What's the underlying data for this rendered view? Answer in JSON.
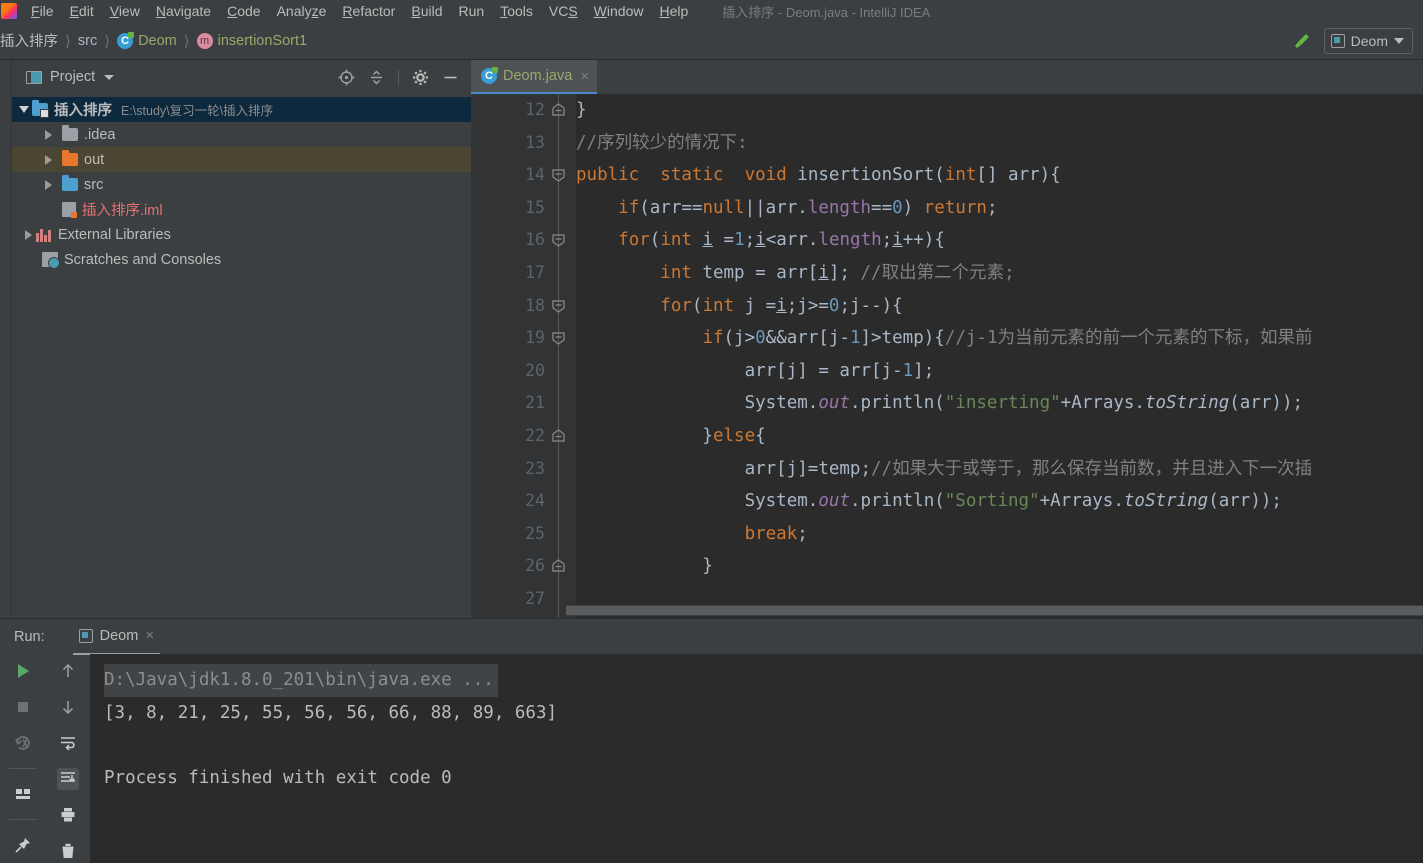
{
  "window": {
    "title": "插入排序 - Deom.java - IntelliJ IDEA"
  },
  "menubar": {
    "items": [
      {
        "label": "File"
      },
      {
        "label": "Edit"
      },
      {
        "label": "View"
      },
      {
        "label": "Navigate"
      },
      {
        "label": "Code"
      },
      {
        "label": "Analyze"
      },
      {
        "label": "Refactor"
      },
      {
        "label": "Build"
      },
      {
        "label": "Run"
      },
      {
        "label": "Tools"
      },
      {
        "label": "VCS"
      },
      {
        "label": "Window"
      },
      {
        "label": "Help"
      }
    ]
  },
  "navbar": {
    "crumbs": [
      {
        "label": "插入排序",
        "icon": "none"
      },
      {
        "label": "src",
        "icon": "none"
      },
      {
        "label": "Deom",
        "icon": "class-icon"
      },
      {
        "label": "insertionSort1",
        "icon": "method-icon"
      }
    ],
    "build_icon": "hammer-icon",
    "run_config": {
      "label": "Deom",
      "icon": "run-window-icon"
    }
  },
  "project_panel": {
    "title": "Project",
    "toolbar": [
      {
        "name": "locate-icon"
      },
      {
        "name": "collapse-all-icon"
      },
      {
        "name": "gear-icon"
      },
      {
        "name": "minimize-icon"
      }
    ],
    "tree": [
      {
        "label": "插入排序",
        "path": "E:\\study\\复习一轮\\插入排序",
        "indent": 0,
        "twisty": "down",
        "icon": "module-folder",
        "state": "selected"
      },
      {
        "label": ".idea",
        "path": "",
        "indent": 1,
        "twisty": "right",
        "icon": "folder-grey",
        "state": "normal"
      },
      {
        "label": "out",
        "path": "",
        "indent": 1,
        "twisty": "right",
        "icon": "folder-orange",
        "state": "hover"
      },
      {
        "label": "src",
        "path": "",
        "indent": 1,
        "twisty": "right",
        "icon": "folder-blue",
        "state": "normal"
      },
      {
        "label": "插入排序.iml",
        "path": "",
        "indent": 2,
        "twisty": "none",
        "icon": "iml-file",
        "state": "normal"
      },
      {
        "label": "External Libraries",
        "path": "",
        "indent": 0,
        "twisty": "right",
        "icon": "library-icon",
        "state": "normal"
      },
      {
        "label": "Scratches and Consoles",
        "path": "",
        "indent": 0,
        "twisty": "none",
        "icon": "scratch-icon",
        "state": "normal"
      }
    ]
  },
  "editor": {
    "tab": {
      "label": "Deom.java",
      "icon": "class-icon",
      "close": "×"
    },
    "lines": [
      {
        "no": "12",
        "fold": "end"
      },
      {
        "no": "13",
        "fold": "none"
      },
      {
        "no": "14",
        "fold": "start"
      },
      {
        "no": "15",
        "fold": "none"
      },
      {
        "no": "16",
        "fold": "start"
      },
      {
        "no": "17",
        "fold": "none"
      },
      {
        "no": "18",
        "fold": "start"
      },
      {
        "no": "19",
        "fold": "start"
      },
      {
        "no": "20",
        "fold": "none"
      },
      {
        "no": "21",
        "fold": "none"
      },
      {
        "no": "22",
        "fold": "end"
      },
      {
        "no": "23",
        "fold": "none"
      },
      {
        "no": "24",
        "fold": "none"
      },
      {
        "no": "25",
        "fold": "none"
      },
      {
        "no": "26",
        "fold": "end"
      },
      {
        "no": "27",
        "fold": "none"
      }
    ],
    "source_text": [
      "    }",
      "    //序列较少的情况下:",
      "    public  static  void insertionSort(int[] arr){",
      "        if(arr==null||arr.length==0) return;",
      "        for(int i =1;i<arr.length;i++){",
      "            int temp = arr[i]; //取出第二个元素;",
      "            for(int j =i;j>=0;j--){",
      "                if(j>0&&arr[j-1]>temp){//j-1为当前元素的前一个元素的下标，如果前",
      "                    arr[j] = arr[j-1];",
      "                    System.out.println(\"inserting\"+Arrays.toString(arr));",
      "                }else{",
      "                    arr[j]=temp;//如果大于或等于，那么保存当前数，并且进入下一次插",
      "                    System.out.println(\"Sorting\"+Arrays.toString(arr));",
      "                    break;",
      "                }",
      ""
    ]
  },
  "run_panel": {
    "label": "Run:",
    "tab": {
      "label": "Deom",
      "icon": "run-window-icon",
      "close": "×"
    },
    "tools_left": [
      {
        "name": "run-icon"
      },
      {
        "name": "stop-icon"
      },
      {
        "name": "rerun-failed-tests-icon"
      },
      {
        "name": "layout-icon"
      },
      {
        "name": "pin-icon"
      }
    ],
    "tools_right": [
      {
        "name": "up-arrow-icon"
      },
      {
        "name": "down-arrow-icon"
      },
      {
        "name": "soft-wrap-icon"
      },
      {
        "name": "scroll-to-end-icon"
      },
      {
        "name": "print-icon"
      },
      {
        "name": "trash-icon"
      }
    ],
    "console": [
      {
        "text": "D:\\Java\\jdk1.8.0_201\\bin\\java.exe ...",
        "kind": "command"
      },
      {
        "text": "[3, 8, 21, 25, 55, 56, 56, 66, 88, 89, 663]",
        "kind": "output"
      },
      {
        "text": "",
        "kind": "output"
      },
      {
        "text": "Process finished with exit code 0",
        "kind": "output"
      }
    ]
  },
  "colors": {
    "background": "#3c3f41",
    "editor_background": "#2b2b2b",
    "keyword": "#cc7832",
    "string": "#6a8759",
    "number": "#6897bb",
    "comment": "#808080",
    "field": "#9876aa",
    "selection": "#0d293e",
    "accent": "#4a88c7"
  }
}
